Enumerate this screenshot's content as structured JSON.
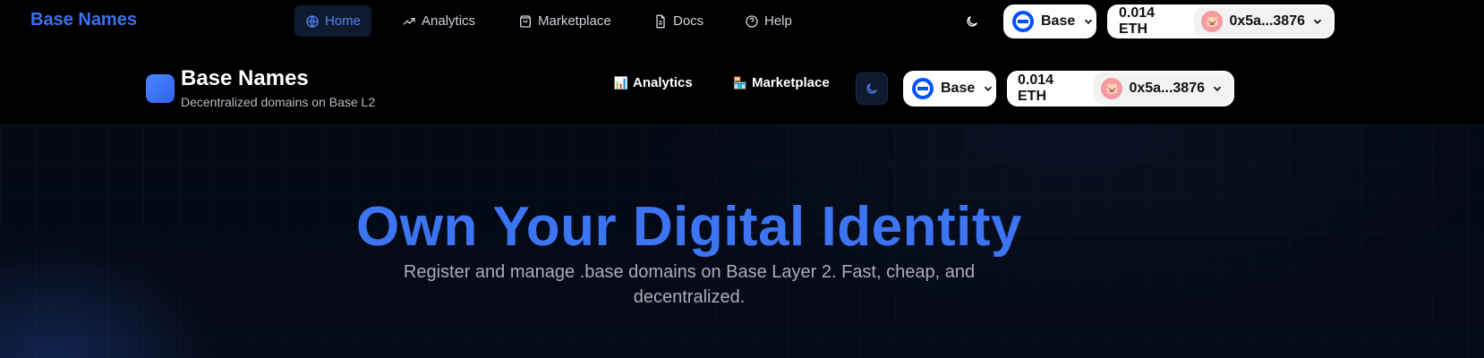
{
  "topnav": {
    "brand": "Base Names",
    "links": [
      {
        "label": "Home",
        "icon": "globe-icon",
        "active": true
      },
      {
        "label": "Analytics",
        "icon": "trending-up-icon",
        "active": false
      },
      {
        "label": "Marketplace",
        "icon": "shopping-bag-icon",
        "active": false
      },
      {
        "label": "Docs",
        "icon": "document-icon",
        "active": false
      },
      {
        "label": "Help",
        "icon": "help-circle-icon",
        "active": false
      }
    ],
    "theme_icon": "moon-icon",
    "network": "Base",
    "balance": "0.014 ETH",
    "address": "0x5a...3876"
  },
  "header": {
    "brand": "Base Names",
    "tagline": "Decentralized domains on Base L2",
    "links": [
      {
        "label": "Analytics",
        "icon": "bar-chart-emoji-icon"
      },
      {
        "label": "Marketplace",
        "icon": "shop-emoji-icon"
      }
    ],
    "theme_icon": "moon-icon",
    "network": "Base",
    "balance": "0.014 ETH",
    "address": "0x5a...3876"
  },
  "hero": {
    "title": "Own Your Digital Identity",
    "subtitle": "Register and manage .base domains on Base Layer 2. Fast, cheap, and decentralized."
  },
  "colors": {
    "accent": "#3c74f2",
    "chain_blue": "#0052ff",
    "background": "#000000"
  }
}
